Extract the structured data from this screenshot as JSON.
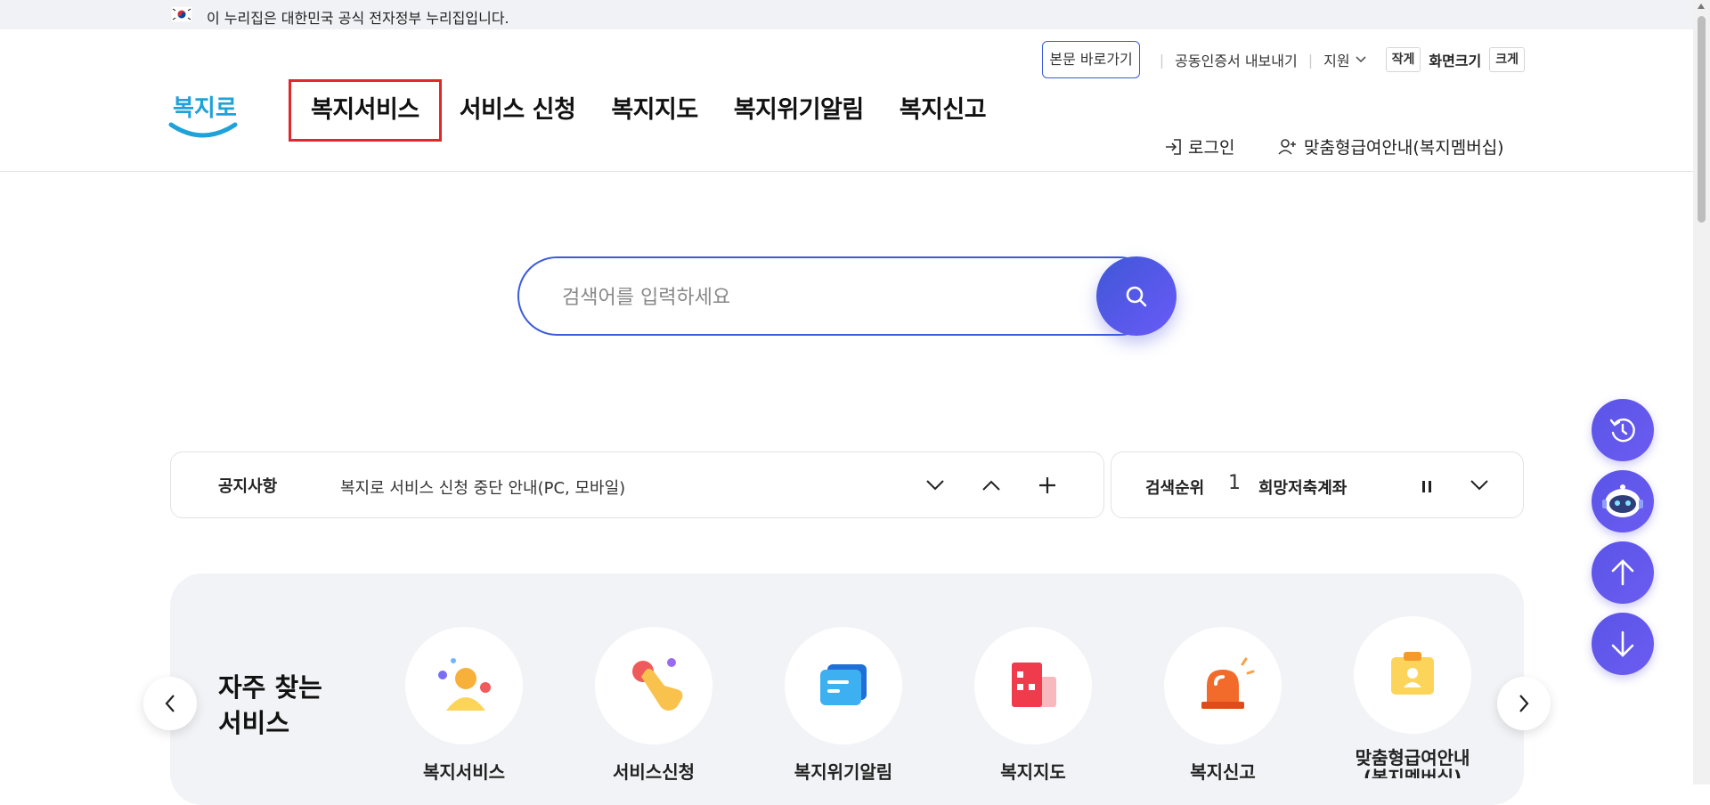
{
  "gov_banner": {
    "text": "이 누리집은 대한민국 공식 전자정부 누리집입니다."
  },
  "header": {
    "logo_text": "복지로",
    "nav": [
      {
        "label": "복지서비스"
      },
      {
        "label": "서비스 신청"
      },
      {
        "label": "복지지도"
      },
      {
        "label": "복지위기알림"
      },
      {
        "label": "복지신고"
      }
    ],
    "util": {
      "skip_label": "본문 바로가기",
      "cert_label": "공동인증서 내보내기",
      "support_label": "지원",
      "small_label": "작게",
      "fontsize_label": "화면크기",
      "large_label": "크게"
    },
    "login_label": "로그인",
    "member_label": "맞춤형급여안내(복지멤버십)"
  },
  "search": {
    "placeholder": "검색어를 입력하세요"
  },
  "notice": {
    "label": "공지사항",
    "text": "복지로 서비스 신청 중단 안내(PC, 모바일)"
  },
  "rank": {
    "label": "검색순위",
    "number": "1",
    "keyword": "희망저축계좌"
  },
  "favorites": {
    "title": "자주 찾는 서비스",
    "items": [
      {
        "name": "복지서비스",
        "icon": "person-icon"
      },
      {
        "name": "서비스신청",
        "icon": "hand-tap-icon"
      },
      {
        "name": "복지위기알림",
        "icon": "message-icon"
      },
      {
        "name": "복지지도",
        "icon": "map-building-icon"
      },
      {
        "name": "복지신고",
        "icon": "siren-icon"
      },
      {
        "name": "맞춤형급여안내(복지멤버십)",
        "icon": "id-card-icon"
      }
    ]
  },
  "colors": {
    "accent": "#3b5bdb",
    "highlight": "#e4262b",
    "floating": "#5a54e8"
  }
}
